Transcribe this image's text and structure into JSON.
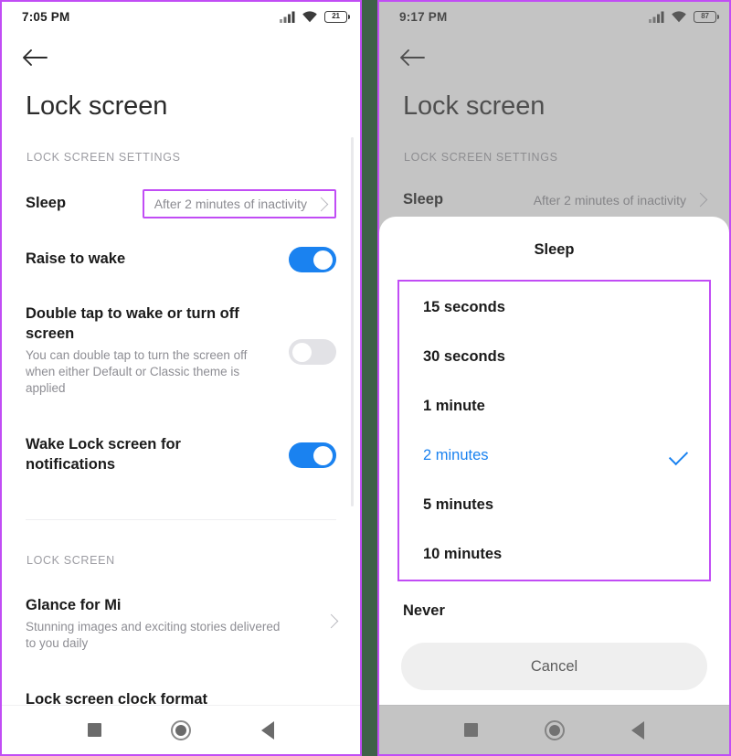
{
  "left_phone": {
    "status_bar": {
      "time": "7:05 PM",
      "signal_icon": "cellular-signal-icon",
      "wifi_icon": "wifi-icon",
      "battery_icon": "battery-icon",
      "battery_level": "21"
    },
    "back_icon": "back-arrow-icon",
    "page_title": "Lock screen",
    "section_1_label": "LOCK SCREEN SETTINGS",
    "section_2_label": "LOCK SCREEN",
    "rows": {
      "sleep": {
        "title": "Sleep",
        "value": "After 2 minutes of inactivity",
        "chevron_icon": "chevron-right-icon"
      },
      "raise_to_wake": {
        "title": "Raise to wake",
        "toggle_state": "on"
      },
      "double_tap": {
        "title": "Double tap to wake or turn off screen",
        "subtitle": "You can double tap to turn the screen off when either Default or Classic theme is applied",
        "toggle_state": "off"
      },
      "wake_lock_screen": {
        "title": "Wake Lock screen for notifications",
        "toggle_state": "on"
      },
      "glance_for_mi": {
        "title": "Glance for Mi",
        "subtitle": "Stunning images and exciting stories delivered to you daily",
        "chevron_icon": "chevron-right-icon"
      },
      "lock_screen_clock_format": {
        "title": "Lock screen clock format"
      }
    },
    "nav_bar": {
      "recents_icon": "square-recents-icon",
      "home_icon": "circle-home-icon",
      "back_icon": "triangle-back-icon"
    }
  },
  "right_phone": {
    "status_bar": {
      "time": "9:17 PM",
      "signal_icon": "cellular-signal-icon",
      "wifi_icon": "wifi-icon",
      "battery_icon": "battery-icon",
      "battery_level": "87"
    },
    "back_icon": "back-arrow-icon",
    "page_title": "Lock screen",
    "section_1_label": "LOCK SCREEN SETTINGS",
    "rows": {
      "sleep": {
        "title": "Sleep",
        "value": "After 2 minutes of inactivity",
        "chevron_icon": "chevron-right-icon"
      }
    },
    "dialog": {
      "title": "Sleep",
      "options": [
        {
          "label": "15 seconds",
          "selected": false
        },
        {
          "label": "30 seconds",
          "selected": false
        },
        {
          "label": "1 minute",
          "selected": false
        },
        {
          "label": "2 minutes",
          "selected": true
        },
        {
          "label": "5 minutes",
          "selected": false
        },
        {
          "label": "10 minutes",
          "selected": false
        }
      ],
      "never_option": "Never",
      "check_icon": "checkmark-icon",
      "cancel_label": "Cancel"
    },
    "nav_bar": {
      "recents_icon": "square-recents-icon",
      "home_icon": "circle-home-icon",
      "back_icon": "triangle-back-icon"
    }
  },
  "colors": {
    "highlight_border": "#c14df5",
    "accent_blue": "#1a82f0",
    "background_gap": "#3f6148"
  }
}
